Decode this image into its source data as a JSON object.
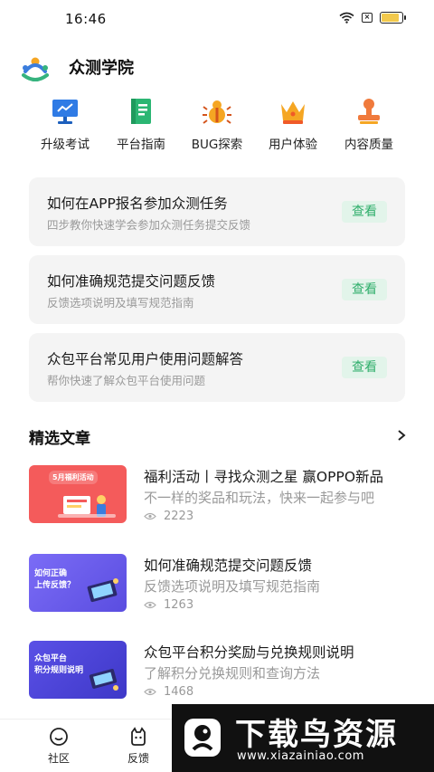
{
  "status": {
    "time": "16:46",
    "battery_level": 0.85,
    "icons": [
      "wifi-icon",
      "sim-off-icon",
      "battery-icon"
    ]
  },
  "header": {
    "title": "众测学院"
  },
  "quick_menu": [
    {
      "label": "升级考试",
      "icon": "monitor-chart-icon"
    },
    {
      "label": "平台指南",
      "icon": "guide-book-icon"
    },
    {
      "label": "BUG探索",
      "icon": "bug-icon"
    },
    {
      "label": "用户体验",
      "icon": "crown-icon"
    },
    {
      "label": "内容质量",
      "icon": "stamp-icon"
    }
  ],
  "guides": [
    {
      "title": "如何在APP报名参加众测任务",
      "desc": "四步教你快速学会参加众测任务提交反馈",
      "action": "查看"
    },
    {
      "title": "如何准确规范提交问题反馈",
      "desc": "反馈选项说明及填写规范指南",
      "action": "查看"
    },
    {
      "title": "众包平台常见用户使用问题解答",
      "desc": "帮你快速了解众包平台使用问题",
      "action": "查看"
    }
  ],
  "section": {
    "title": "精选文章"
  },
  "articles": [
    {
      "title": "福利活动丨寻找众测之星 赢OPPO新品",
      "desc": "不一样的奖品和玩法，快来一起参与吧",
      "views": "2223",
      "thumb_text": "5月福利活动"
    },
    {
      "title": "如何准确规范提交问题反馈",
      "desc": "反馈选项说明及填写规范指南",
      "views": "1263",
      "thumb_text": "如何正确\n上传反馈？"
    },
    {
      "title": "众包平台积分奖励与兑换规则说明",
      "desc": "了解积分兑换规则和查询方法",
      "views": "1468",
      "thumb_text": "众包平台\n积分规则说明"
    }
  ],
  "tabs": [
    {
      "label": "社区",
      "icon": "community-icon"
    },
    {
      "label": "反馈",
      "icon": "feedback-icon"
    }
  ],
  "watermark": {
    "title": "下载鸟资源",
    "url": "www.xiazainiao.com"
  },
  "colors": {
    "accent_green": "#2fae6b",
    "accent_green_bg": "#e2f4ea",
    "card_bg": "#f4f4f4",
    "thumb_red": "#f45b5b",
    "thumb_purple": "#6a5cf0",
    "thumb_indigo": "#4b45d8"
  }
}
